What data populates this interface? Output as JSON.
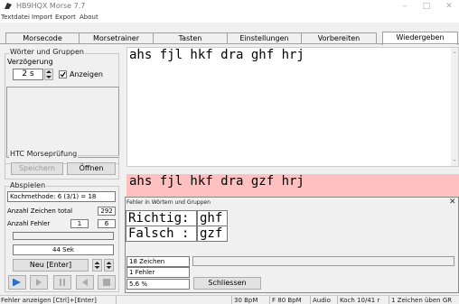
{
  "window": {
    "title": "HB9HQX Morse 7.7"
  },
  "menu": [
    "Textdatei",
    "Import",
    "Export",
    "About"
  ],
  "tabs": [
    "Morsecode",
    "Morsetrainer",
    "Tasten",
    "Einstellungen",
    "Vorbereiten",
    "Wiedergeben"
  ],
  "active_tab": "Wiedergeben",
  "groups": {
    "words": {
      "label": "Wörter und Gruppen",
      "delay_label": "Verzögerung",
      "delay_value": "2 s",
      "show_label": "Anzeigen",
      "show_checked": true
    },
    "htc": {
      "label": "HTC Morseprüfung",
      "save_button": "Speichern",
      "open_button": "Öffnen"
    },
    "playback": {
      "label": "Abspielen",
      "method": "Kochmethode: 6 (3/1) = 18",
      "total_label": "Anzahl Zeichen total",
      "total_value": "292",
      "errors_label": "Anzahl Fehler",
      "errors_value_1": "1",
      "errors_value_2": "6",
      "time": "44 Sek",
      "new_button": "Neu  [Enter]"
    }
  },
  "main_text": "ahs fjl hkf dra ghf hrj",
  "error_text": "ahs fjl hkf dra gzf hrj",
  "error_dialog": {
    "title": "Fehler in Wörtern und Gruppen",
    "correct_label": "Richtig:",
    "correct_value": "ghf",
    "wrong_label": "Falsch :",
    "wrong_value": "gzf",
    "chars": "18 Zeichen",
    "errors": "1 Fehler",
    "percent": "5.6 %",
    "close_button": "Schliessen"
  },
  "status_bar": {
    "left": "Fehler anzeigen  [Ctrl]+[Enter]",
    "bpm": "30 BpM",
    "fbpm": "F 80 BpM",
    "audio": "Audio",
    "koch": "Koch 10/41  r",
    "info": "1 Zeichen  üben  GR"
  },
  "colors": {
    "error_bg": "#ffc0c0",
    "accent_blue": "#2a6fc9"
  }
}
